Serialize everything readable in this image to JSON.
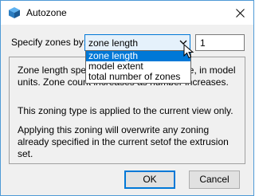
{
  "window": {
    "title": "Autozone",
    "app_icon": "cube-icon",
    "close_icon": "close-icon"
  },
  "form": {
    "label": "Specify zones by:",
    "combo_value": "zone length",
    "number_value": "1"
  },
  "dropdown": {
    "options": [
      "zone length",
      "model extent",
      "total number of zones"
    ],
    "selected_index": 0
  },
  "info": {
    "p1": "Zone length specifies the target zone size, in model units.  Zone count increases as number increases.",
    "p2": "This zoning type is applied to the current view only.",
    "p3": "Applying this zoning will overwrite any zoning already specified in the current setof the extrusion set."
  },
  "buttons": {
    "ok": "OK",
    "cancel": "Cancel"
  },
  "colors": {
    "accent": "#0078d7",
    "window_bg": "#f0f0f0"
  }
}
